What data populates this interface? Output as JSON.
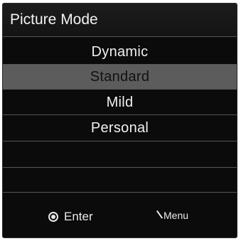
{
  "title": "Picture Mode",
  "options": [
    {
      "label": "Dynamic",
      "selected": false
    },
    {
      "label": "Standard",
      "selected": true
    },
    {
      "label": "Mild",
      "selected": false
    },
    {
      "label": "Personal",
      "selected": false
    }
  ],
  "footer": {
    "enter_icon": "enter-circle-icon",
    "enter_label": "Enter",
    "menu_icon": "back-slash-icon",
    "menu_label": "Menu"
  },
  "colors": {
    "background": "#0b0b0b",
    "selected_row": "#5c5c5c",
    "text": "#f0f0f0"
  }
}
